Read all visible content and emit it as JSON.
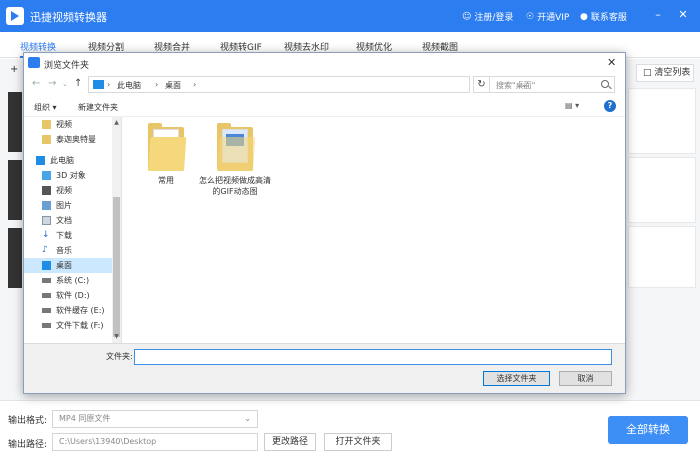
{
  "app": {
    "title": "迅捷视频转换器",
    "login": "注册/登录",
    "vip": "开通VIP",
    "support": "联系客服"
  },
  "tabs": [
    "视频转换",
    "视频分割",
    "视频合并",
    "视频转GIF",
    "视频去水印",
    "视频优化",
    "视频截图"
  ],
  "toolbar": {
    "clear_list": "清空列表"
  },
  "bottom": {
    "output_format_label": "输出格式:",
    "output_format_value": "MP4  同原文件",
    "output_path_label": "输出路径:",
    "output_path_value": "C:\\Users\\13940\\Desktop",
    "change_path": "更改路径",
    "open_folder": "打开文件夹",
    "convert_all": "全部转换"
  },
  "dialog": {
    "title": "浏览文件夹",
    "breadcrumb": [
      "此电脑",
      "桌面"
    ],
    "search_placeholder": "搜索\"桌面\"",
    "organize": "组织",
    "new_folder": "新建文件夹",
    "nav": [
      {
        "label": "视频",
        "icon": "folder-icon"
      },
      {
        "label": "泰迦奥特曼",
        "icon": "folder-icon"
      },
      {
        "label": "此电脑",
        "icon": "pc-icon"
      },
      {
        "label": "3D 对象",
        "icon": "cube-icon"
      },
      {
        "label": "视频",
        "icon": "video-icon"
      },
      {
        "label": "图片",
        "icon": "picture-icon"
      },
      {
        "label": "文档",
        "icon": "document-icon"
      },
      {
        "label": "下载",
        "icon": "download-icon"
      },
      {
        "label": "音乐",
        "icon": "music-icon"
      },
      {
        "label": "桌面",
        "icon": "desktop-icon"
      },
      {
        "label": "系统 (C:)",
        "icon": "drive-icon"
      },
      {
        "label": "软件 (D:)",
        "icon": "drive-icon"
      },
      {
        "label": "软件缓存 (E:)",
        "icon": "drive-icon"
      },
      {
        "label": "文件下载 (F:)",
        "icon": "drive-icon"
      }
    ],
    "files": [
      {
        "name": "常用"
      },
      {
        "name": "怎么把视频做成高清的GIF动态图"
      }
    ],
    "folder_label": "文件夹:",
    "folder_value": "",
    "select_button": "选择文件夹",
    "cancel_button": "取消"
  }
}
